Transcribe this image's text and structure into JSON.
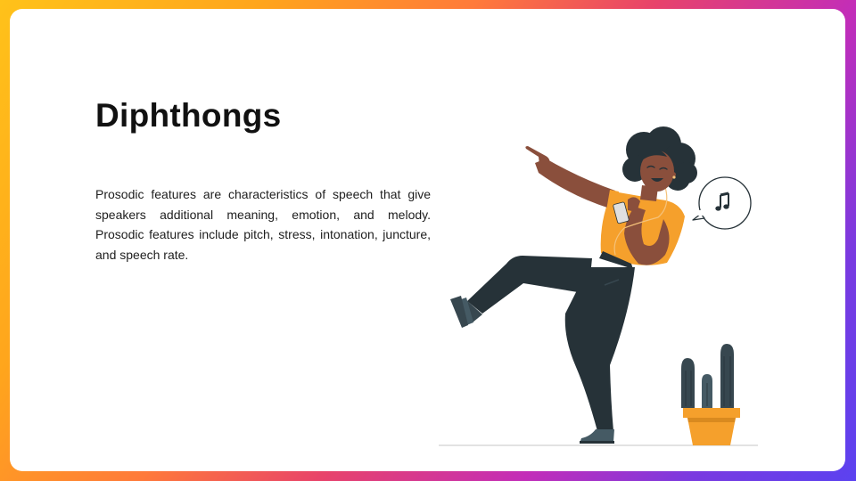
{
  "slide": {
    "title": "Diphthongs",
    "body": "Prosodic features are characteristics of speech that give speakers additional meaning, emotion, and melody. Prosodic features include pitch, stress, intonation, juncture, and speech rate."
  },
  "illustration": {
    "subject": "dancing-woman",
    "accent_color": "#f5a02c",
    "dark_color": "#263238",
    "skin_color": "#8a4f3c",
    "speech_bubble_icon": "music-note-icon",
    "plant": "cactus"
  },
  "colors": {
    "frame_gradient": [
      "#ffc21a",
      "#ff7a3a",
      "#c32db8",
      "#5b42f0"
    ],
    "card": "#ffffff",
    "title": "#111111",
    "text": "#1e1e1e"
  }
}
